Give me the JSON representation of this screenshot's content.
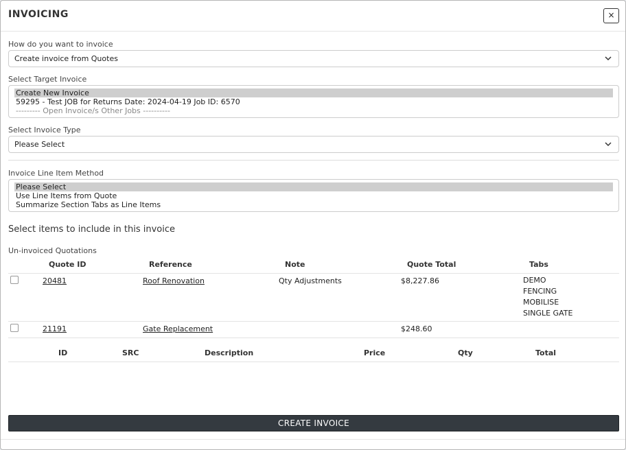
{
  "modal": {
    "title": "INVOICING",
    "close_label": "×"
  },
  "invoice_method": {
    "label": "How do you want to invoice",
    "selected": "Create invoice from Quotes"
  },
  "target_invoice": {
    "label": "Select Target Invoice",
    "options": [
      "Create New Invoice",
      "59295 - Test JOB for Returns Date: 2024-04-19 Job ID: 6570",
      "--------- Open Invoice/s Other Jobs ----------"
    ],
    "selected_index": 0
  },
  "invoice_type": {
    "label": "Select Invoice Type",
    "selected": "Please Select"
  },
  "line_item_method": {
    "label": "Invoice Line Item Method",
    "options": [
      "Please Select",
      "Use Line Items from Quote",
      "Summarize Section Tabs as Line Items"
    ],
    "selected_index": 0
  },
  "items_section": {
    "title": "Select items to include in this invoice"
  },
  "quotations": {
    "label": "Un-invoiced Quotations",
    "headers": {
      "id": "Quote ID",
      "reference": "Reference",
      "note": "Note",
      "total": "Quote Total",
      "tabs": "Tabs"
    },
    "rows": [
      {
        "id": "20481",
        "reference": "Roof Renovation",
        "note": "Qty Adjustments",
        "total": "$8,227.86",
        "tabs": [
          "DEMO",
          "FENCING",
          "MOBILISE",
          "SINGLE GATE"
        ],
        "checked": false
      },
      {
        "id": "21191",
        "reference": "Gate Replacement",
        "note": "",
        "total": "$248.60",
        "tabs": [],
        "checked": false
      }
    ]
  },
  "line_items": {
    "headers": {
      "id": "ID",
      "src": "SRC",
      "description": "Description",
      "price": "Price",
      "qty": "Qty",
      "total": "Total"
    }
  },
  "actions": {
    "create_label": "CREATE INVOICE"
  }
}
